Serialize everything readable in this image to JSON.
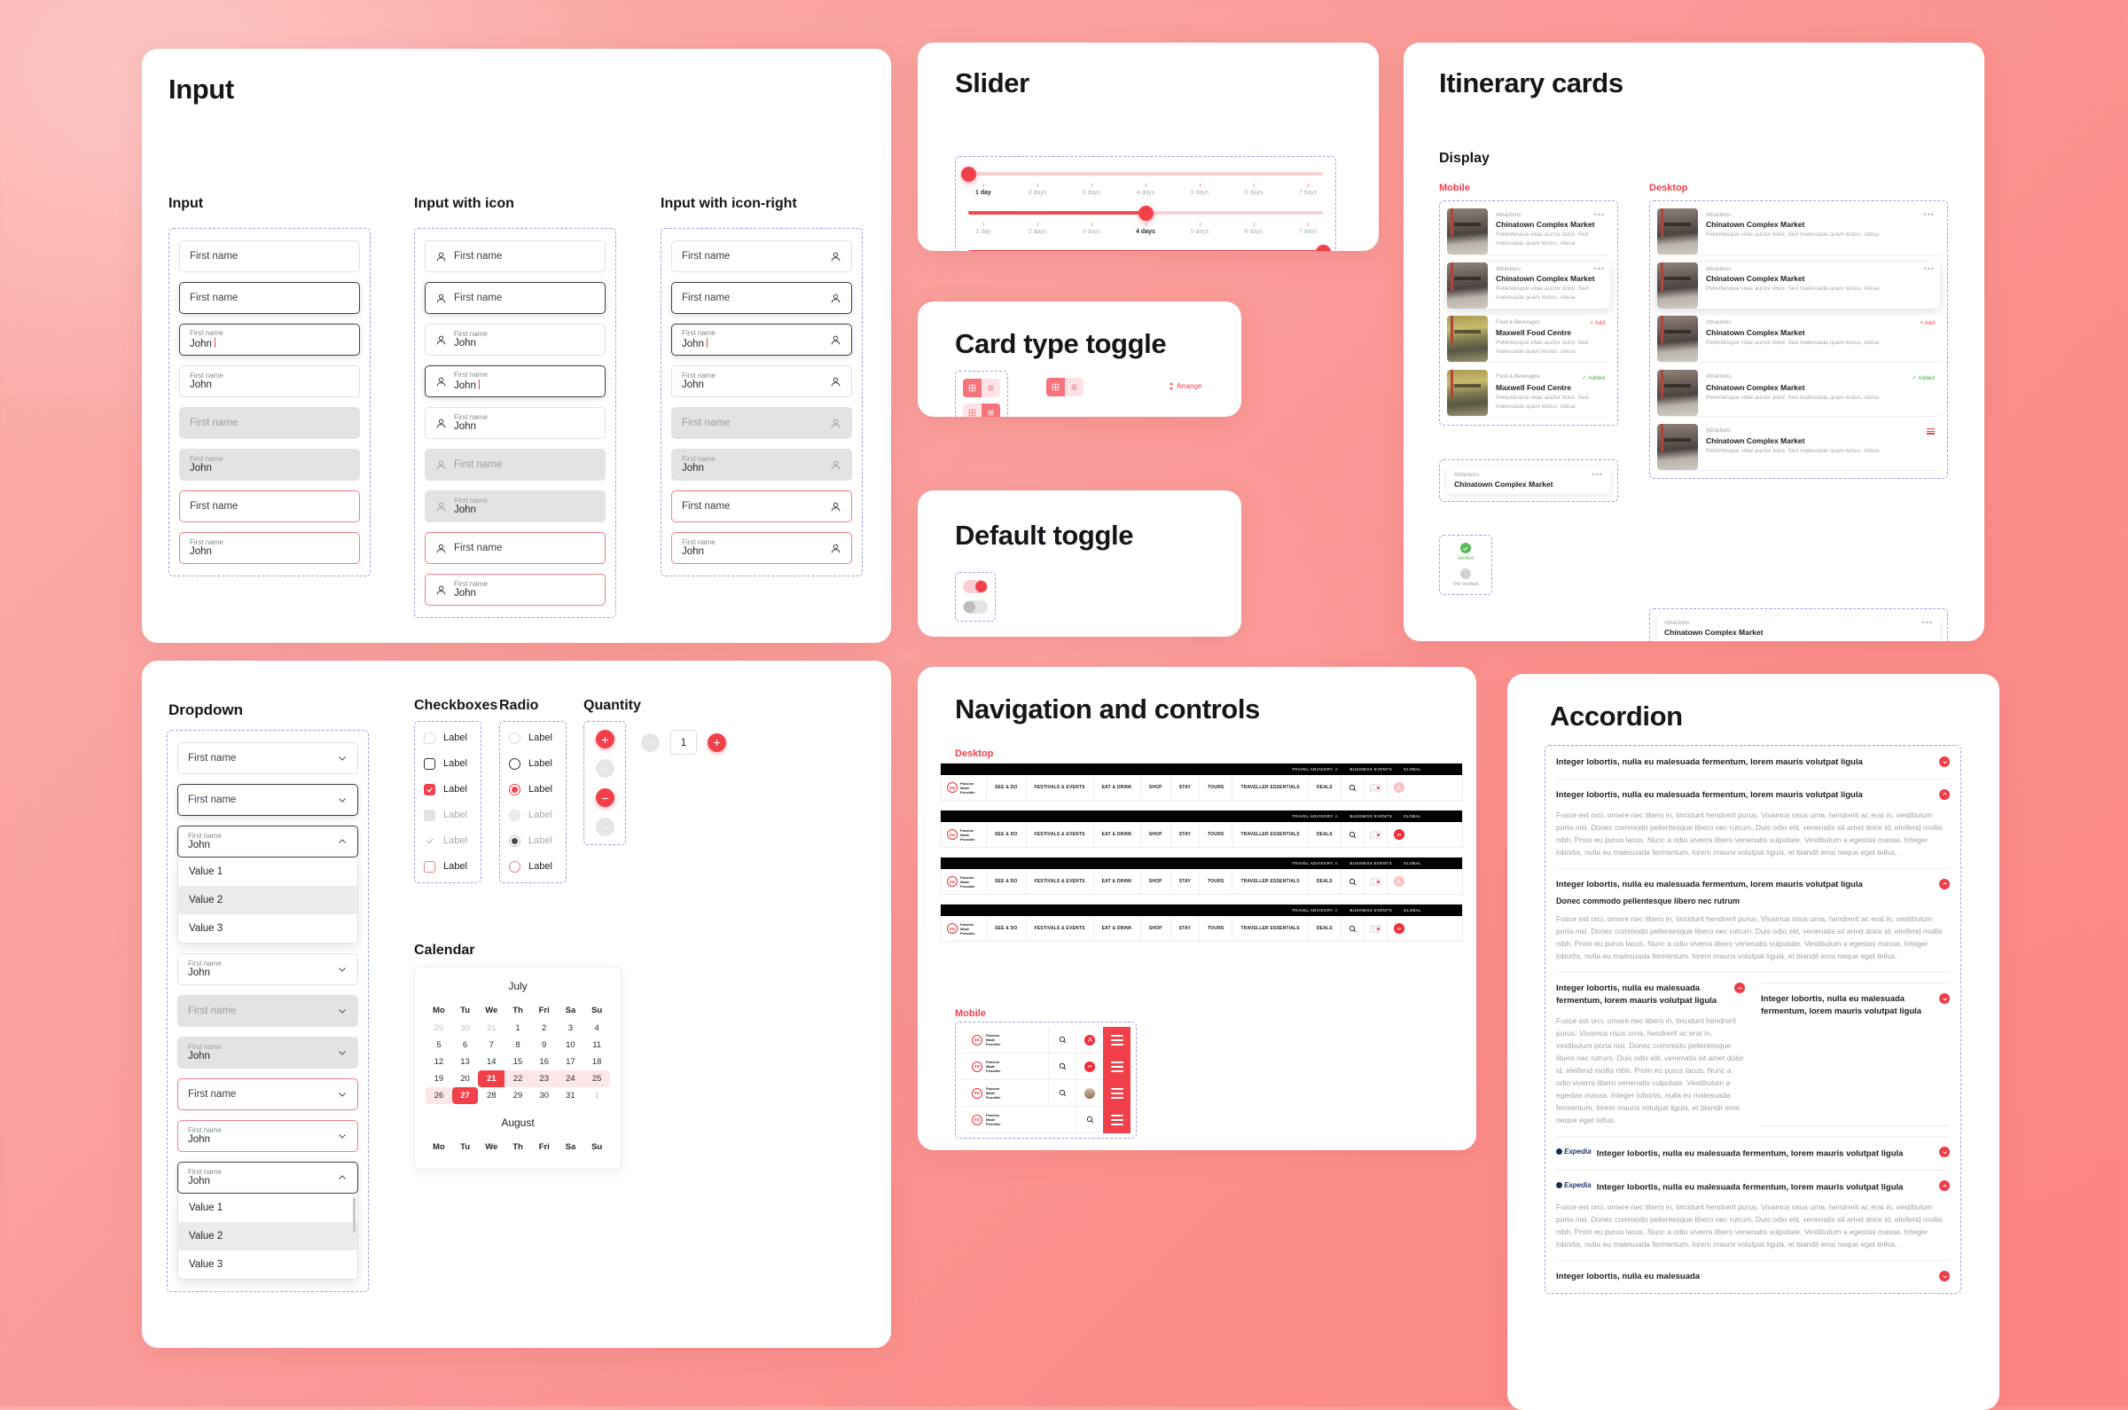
{
  "panels": {
    "input": "Input",
    "slider": "Slider",
    "itinerary": "Itinerary cards",
    "card_toggle": "Card type toggle",
    "default_toggle": "Default toggle",
    "dropdown": "Dropdown",
    "checkboxes": "Checkboxes",
    "radio": "Radio",
    "quantity": "Quantity",
    "calendar": "Calendar",
    "navigation": "Navigation and controls",
    "accordion": "Accordion"
  },
  "input": {
    "col1_title": "Input",
    "col2_title": "Input with icon",
    "col3_title": "Input with icon-right",
    "placeholder": "First name",
    "label": "First name",
    "value": "John",
    "icon": "user-icon",
    "states": [
      "rest",
      "focus",
      "typing",
      "filled",
      "disabled",
      "disabled-filled",
      "error",
      "error-filled"
    ]
  },
  "dropdown": {
    "placeholder": "First name",
    "label": "First name",
    "value": "John",
    "options": [
      "Value 1",
      "Value 2",
      "Value 3"
    ],
    "chevron_down": "chevron-down-icon",
    "chevron_up": "chevron-up-icon"
  },
  "checkboxes": {
    "label": "Label",
    "items": [
      "rest",
      "hover",
      "checked",
      "disabled",
      "disabled-checked",
      "error"
    ]
  },
  "radio": {
    "label": "Label",
    "items": [
      "rest",
      "hover",
      "selected",
      "disabled",
      "disabled-selected",
      "error"
    ]
  },
  "quantity": {
    "value": "1",
    "plus": "+",
    "minus": "−"
  },
  "calendar": {
    "months": [
      {
        "name": "July",
        "weekdays": [
          "Mo",
          "Tu",
          "We",
          "Th",
          "Fri",
          "Sa",
          "Su"
        ],
        "weeks": [
          [
            {
              "d": "29",
              "s": "mut"
            },
            {
              "d": "30",
              "s": "mut"
            },
            {
              "d": "31",
              "s": "mut"
            },
            {
              "d": "1",
              "s": ""
            },
            {
              "d": "2",
              "s": ""
            },
            {
              "d": "3",
              "s": ""
            },
            {
              "d": "4",
              "s": ""
            }
          ],
          [
            {
              "d": "5",
              "s": ""
            },
            {
              "d": "6",
              "s": ""
            },
            {
              "d": "7",
              "s": ""
            },
            {
              "d": "8",
              "s": ""
            },
            {
              "d": "9",
              "s": ""
            },
            {
              "d": "10",
              "s": ""
            },
            {
              "d": "11",
              "s": ""
            }
          ],
          [
            {
              "d": "12",
              "s": ""
            },
            {
              "d": "13",
              "s": ""
            },
            {
              "d": "14",
              "s": ""
            },
            {
              "d": "15",
              "s": ""
            },
            {
              "d": "16",
              "s": ""
            },
            {
              "d": "17",
              "s": ""
            },
            {
              "d": "18",
              "s": ""
            }
          ],
          [
            {
              "d": "19",
              "s": ""
            },
            {
              "d": "20",
              "s": ""
            },
            {
              "d": "21",
              "s": "st"
            },
            {
              "d": "22",
              "s": "inr"
            },
            {
              "d": "23",
              "s": "inr"
            },
            {
              "d": "24",
              "s": "inr"
            },
            {
              "d": "25",
              "s": "inr rr"
            }
          ],
          [
            {
              "d": "26",
              "s": "inr rl"
            },
            {
              "d": "27",
              "s": "en"
            },
            {
              "d": "28",
              "s": ""
            },
            {
              "d": "29",
              "s": ""
            },
            {
              "d": "30",
              "s": ""
            },
            {
              "d": "31",
              "s": ""
            },
            {
              "d": "1",
              "s": "mut"
            }
          ]
        ]
      },
      {
        "name": "August",
        "weekdays": [
          "Mo",
          "Tu",
          "We",
          "Th",
          "Fri",
          "Sa",
          "Su"
        ],
        "weeks": []
      }
    ]
  },
  "slider": {
    "ticks": [
      "1 day",
      "2 days",
      "3 days",
      "4 days",
      "5 days",
      "6 days",
      "7 days"
    ],
    "rows": [
      {
        "value": 1
      },
      {
        "value": 4
      },
      {
        "value": 7
      }
    ]
  },
  "card_toggle": {
    "arrange_label": "Arrange",
    "grid_icon": "grid-view-icon",
    "list_icon": "list-view-icon"
  },
  "itinerary": {
    "display_label": "Display",
    "mobile_label": "Mobile",
    "desktop_label": "Desktop",
    "verified_label": "Verified",
    "not_verified_label": "Not Verified",
    "add_label": "+ Add",
    "added_label": "✓ Added",
    "dots": "•••",
    "description": "Pellentesque vitae auctor dolor. Sed malesuada quam lectus, sitesa",
    "mobile_cards": [
      {
        "category": "Attractions",
        "name": "Chinatown Complex Market",
        "action": "dots",
        "thumb": "attraction"
      },
      {
        "category": "Attractions",
        "name": "Chinatown Complex Market",
        "action": "dots",
        "thumb": "attraction"
      },
      {
        "category": "Food & Beverages",
        "name": "Maxwell Food Centre",
        "action": "add",
        "thumb": "food"
      },
      {
        "category": "Food & Beverages",
        "name": "Maxwell Food Centre",
        "action": "added",
        "thumb": "food"
      }
    ],
    "mobile_compact": {
      "category": "Attractions",
      "name": "Chinatown Complex Market",
      "action": "dots"
    },
    "desktop_cards": [
      {
        "category": "Attractions",
        "name": "Chinatown Complex Market",
        "action": "dots",
        "thumb": "attraction"
      },
      {
        "category": "Attractions",
        "name": "Chinatown Complex Market",
        "action": "dots",
        "thumb": "attraction"
      },
      {
        "category": "Attractions",
        "name": "Chinatown Complex Market",
        "action": "add",
        "thumb": "attraction"
      },
      {
        "category": "Attractions",
        "name": "Chinatown Complex Market",
        "action": "added",
        "thumb": "attraction"
      },
      {
        "category": "Attractions",
        "name": "Chinatown Complex Market",
        "action": "handle",
        "thumb": "attraction"
      }
    ],
    "desktop_compact": {
      "category": "Attractions",
      "name": "Chinatown Complex Market",
      "action": "dots"
    }
  },
  "navigation": {
    "desktop_label": "Desktop",
    "mobile_label": "Mobile",
    "top_links": [
      "TRAVEL ADVISORY",
      "BUSINESS EVENTS",
      "GLOBAL"
    ],
    "logo_line1": "Passion",
    "logo_line2": "Made",
    "logo_line3": "Possible",
    "logo_mark": "SG",
    "menu": [
      "SEE & DO",
      "FESTIVALS & EVENTS",
      "EAT & DRINK",
      "SHOP",
      "STAY",
      "TOURS",
      "TRAVELLER ESSENTIALS",
      "DEALS"
    ],
    "search_icon": "search-icon",
    "map_icon": "map-icon",
    "avatar_icon": "avatar-icon",
    "avatar_initials": "JT",
    "hamburger_icon": "hamburger-menu-icon",
    "rows": [
      {
        "avatar": "light"
      },
      {
        "avatar": "initials"
      },
      {
        "avatar": "light"
      },
      {
        "avatar": "initials"
      }
    ],
    "mobile_rows": [
      {
        "avatar": "icon"
      },
      {
        "avatar": "initials"
      },
      {
        "avatar": "photo"
      },
      {
        "avatar": "none"
      }
    ]
  },
  "accordion": {
    "title_short": "Integer lobortis, nulla eu malesuada",
    "title": "Integer lobortis, nulla eu malesuada fermentum, lorem mauris volutpat ligula",
    "subtitle": "Donec commodo pellentesque libero nec rutrum",
    "body": "Fusce est orci, ornare nec libero in, tincidunt hendrerit purus. Vivamus risus urna, hendrerit ac erat in, vestibulum porta nisi. Donec commodo pellentesque libero nec rutrum. Duis odio elit, venenatis sit amet dolor id, eleifend mollis nibh. Proin eu purus lacus. Nunc a odio viverra libero venenatis vulputate. Vestibulum a egestas massa. Integer lobortis, nulla eu malesuada fermentum, lorem mauris volutpat ligula, et blandit eros neque eget tellus.",
    "brand": "Expedia",
    "collapse_icon": "chevron-up-icon",
    "expand_icon": "chevron-down-icon"
  }
}
